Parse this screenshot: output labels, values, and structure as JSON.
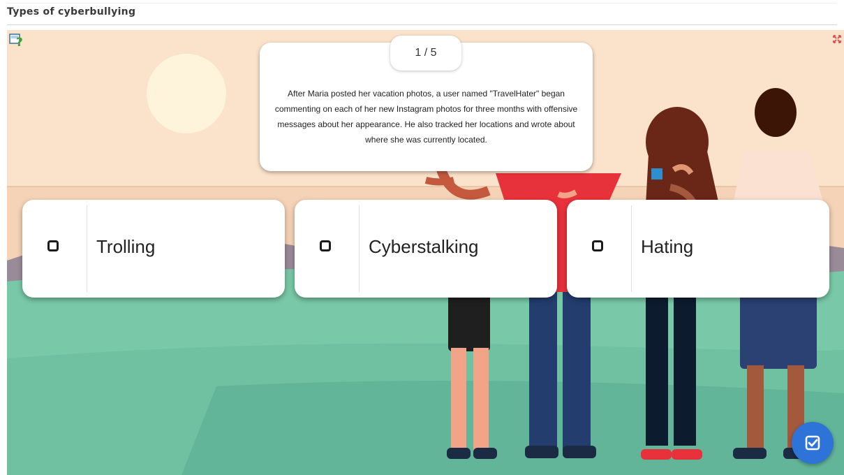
{
  "page": {
    "title": "Types of cyberbullying"
  },
  "question": {
    "counter": "1 / 5",
    "text": "After Maria posted her vacation photos, a user named \"TravelHater\" began commenting on each of her new Instagram photos for three months with offensive messages about her appearance. He also tracked her locations and wrote about where she was currently located."
  },
  "options": [
    {
      "label": "Trolling",
      "checked": false
    },
    {
      "label": "Cyberstalking",
      "checked": false
    },
    {
      "label": "Hating",
      "checked": false
    }
  ],
  "icons": {
    "help": "help-icon",
    "fullscreen": "fullscreen-icon",
    "check": "checkmark-icon"
  },
  "colors": {
    "sky": "#fbe2cb",
    "sun": "#fef4dc",
    "grass": "#7bcdad",
    "accent_button": "#2e73d8"
  }
}
